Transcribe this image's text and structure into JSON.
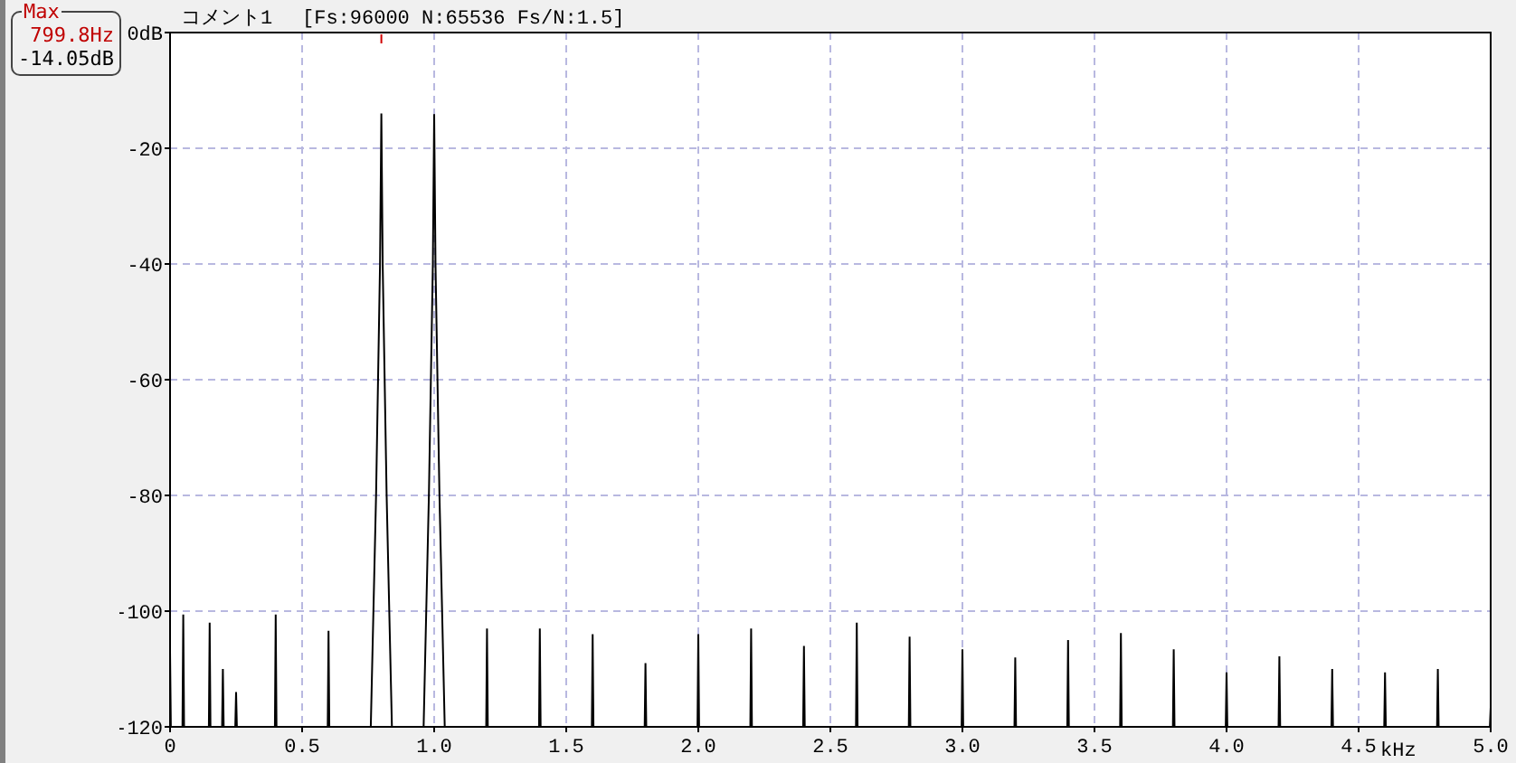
{
  "readout": {
    "title": "Max",
    "frequency": "799.8Hz",
    "level": "-14.05dB"
  },
  "chart": {
    "comment": "コメント1",
    "info": "[Fs:96000 N:65536 Fs/N:1.5]",
    "chart_data": {
      "type": "line",
      "grid": true,
      "xlabel": "kHz",
      "xlim": [
        0,
        5
      ],
      "ylim": [
        -120,
        0
      ],
      "xticks": [
        {
          "value": 0,
          "label": "0"
        },
        {
          "value": 0.5,
          "label": "0.5"
        },
        {
          "value": 1,
          "label": "1.0"
        },
        {
          "value": 1.5,
          "label": "1.5"
        },
        {
          "value": 2,
          "label": "2.0"
        },
        {
          "value": 2.5,
          "label": "2.5"
        },
        {
          "value": 3,
          "label": "3.0"
        },
        {
          "value": 3.5,
          "label": "3.5"
        },
        {
          "value": 4,
          "label": "4.0"
        },
        {
          "value": 4.5,
          "label": "4.5"
        },
        {
          "value": 5,
          "label": "5.0"
        }
      ],
      "yticks": [
        {
          "value": 0,
          "label": "0dB"
        },
        {
          "value": -20,
          "label": "-20"
        },
        {
          "value": -40,
          "label": "-40"
        },
        {
          "value": -60,
          "label": "-60"
        },
        {
          "value": -80,
          "label": "-80"
        },
        {
          "value": -100,
          "label": "-100"
        },
        {
          "value": -120,
          "label": "-120"
        }
      ],
      "x": [
        0,
        0.003,
        0.047,
        0.05,
        0.053,
        0.147,
        0.15,
        0.153,
        0.197,
        0.2,
        0.203,
        0.247,
        0.25,
        0.253,
        0.397,
        0.4,
        0.403,
        0.597,
        0.6,
        0.603,
        0.76,
        0.78,
        0.795,
        0.8,
        0.805,
        0.82,
        0.84,
        0.96,
        0.98,
        0.995,
        1.0,
        1.005,
        1.02,
        1.04,
        1.197,
        1.2,
        1.203,
        1.397,
        1.4,
        1.403,
        1.597,
        1.6,
        1.603,
        1.797,
        1.8,
        1.803,
        1.997,
        2.0,
        2.003,
        2.197,
        2.2,
        2.203,
        2.397,
        2.4,
        2.403,
        2.597,
        2.6,
        2.603,
        2.797,
        2.8,
        2.803,
        2.997,
        3.0,
        3.003,
        3.197,
        3.2,
        3.203,
        3.397,
        3.4,
        3.403,
        3.597,
        3.6,
        3.603,
        3.797,
        3.8,
        3.803,
        3.997,
        4.0,
        4.003,
        4.197,
        4.2,
        4.203,
        4.397,
        4.4,
        4.403,
        4.597,
        4.6,
        4.603,
        4.797,
        4.8,
        4.803,
        4.997,
        5.0
      ],
      "series": [
        {
          "color": "#000000",
          "values": [
            -107,
            -120,
            -120,
            -100.6,
            -120,
            -120,
            -102,
            -120,
            -120,
            -110,
            -120,
            -120,
            -114,
            -120,
            -120,
            -100.6,
            -120,
            -120,
            -103.4,
            -120,
            -120,
            -80,
            -40,
            -14,
            -40,
            -80,
            -120,
            -120,
            -80,
            -40,
            -14.1,
            -40,
            -80,
            -120,
            -120,
            -103,
            -120,
            -120,
            -103,
            -120,
            -120,
            -104,
            -120,
            -120,
            -109,
            -120,
            -120,
            -104,
            -120,
            -120,
            -103,
            -120,
            -120,
            -106,
            -120,
            -120,
            -102,
            -120,
            -120,
            -104.4,
            -120,
            -120,
            -106.6,
            -120,
            -120,
            -108,
            -120,
            -120,
            -105,
            -120,
            -120,
            -103.8,
            -120,
            -120,
            -106.6,
            -120,
            -120,
            -110.6,
            -120,
            -120,
            -107.8,
            -120,
            -120,
            -110,
            -120,
            -120,
            -110.6,
            -120,
            -120,
            -110,
            -120,
            -120,
            -116.6
          ]
        }
      ]
    }
  }
}
